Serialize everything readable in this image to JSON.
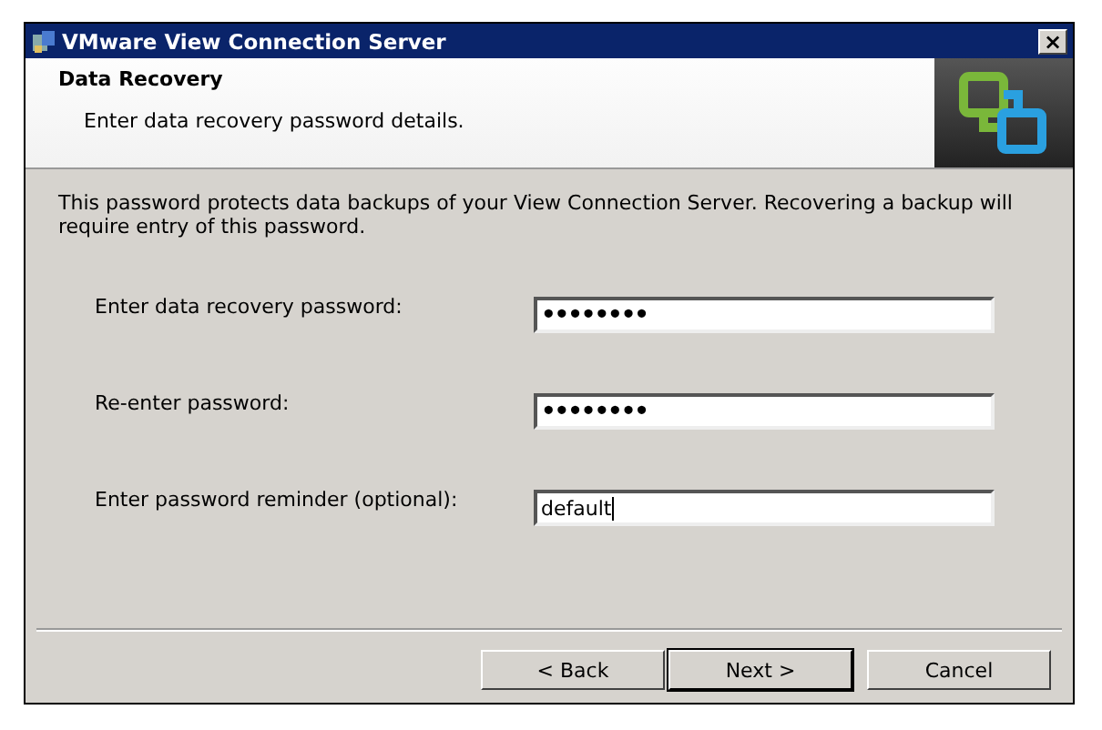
{
  "window": {
    "title": "VMware View Connection Server",
    "close": "×"
  },
  "header": {
    "title": "Data Recovery",
    "subtitle": "Enter data recovery password details."
  },
  "description": "This password protects data backups of your View Connection Server. Recovering a backup will require entry of this password.",
  "fields": [
    {
      "label": "Enter data recovery password:",
      "value": "••••••••",
      "kind": "password",
      "focused": false
    },
    {
      "label": "Re-enter password:",
      "value": "••••••••",
      "kind": "password",
      "focused": false
    },
    {
      "label": "Enter password reminder (optional):",
      "value": "default",
      "kind": "text",
      "focused": true
    }
  ],
  "buttons": [
    {
      "label": "< Back",
      "default": false
    },
    {
      "label": "Next >",
      "default": true
    },
    {
      "label": "Cancel",
      "default": false
    }
  ]
}
